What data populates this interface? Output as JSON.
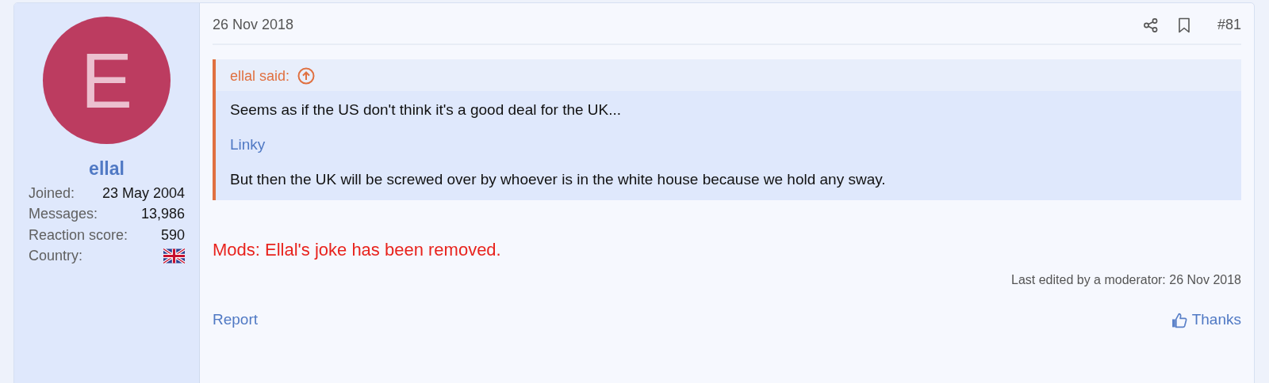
{
  "user": {
    "avatar_letter": "E",
    "name": "ellal",
    "stats": [
      {
        "kind": "text",
        "label": "Joined:",
        "value": "23 May 2004"
      },
      {
        "kind": "text",
        "label": "Messages:",
        "value": "13,986"
      },
      {
        "kind": "text",
        "label": "Reaction score:",
        "value": "590"
      },
      {
        "kind": "flag",
        "label": "Country:"
      }
    ]
  },
  "post": {
    "date": "26 Nov 2018",
    "number": "#81",
    "quote": {
      "author": "ellal said:",
      "paragraphs": [
        {
          "kind": "text",
          "text": "Seems as if the US don't think it's a good deal for the UK..."
        },
        {
          "kind": "link",
          "text": "Linky"
        },
        {
          "kind": "text",
          "text": "But then the UK will be screwed over by whoever is in the white house because we hold any sway."
        }
      ]
    },
    "notice": "Mods: Ellal's joke has been removed.",
    "last_edited": "Last edited by a moderator: 26 Nov 2018",
    "actions": {
      "report": "Report",
      "thanks": "Thanks"
    }
  }
}
